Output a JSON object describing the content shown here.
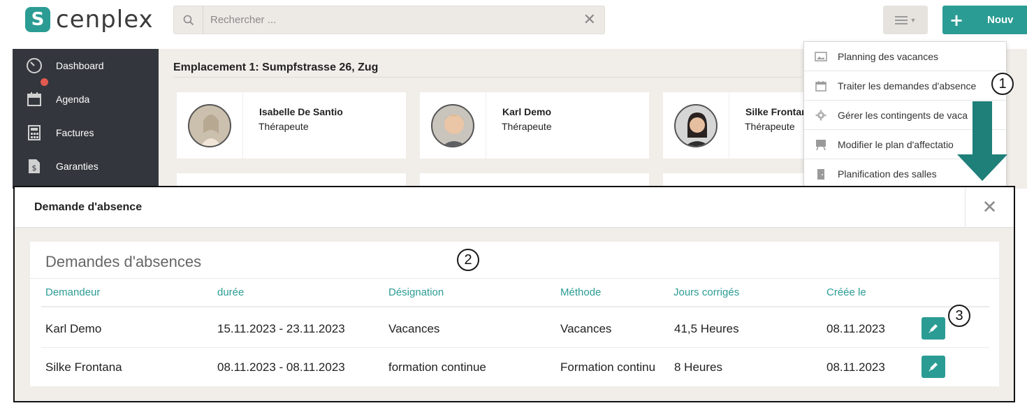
{
  "header": {
    "logo_mark": "S",
    "logo_text": "cenplex",
    "search_placeholder": "Rechercher ...",
    "menu_icon": "hamburger-icon",
    "new_button_label": "Nouv"
  },
  "sidebar": {
    "items": [
      {
        "label": "Dashboard",
        "icon": "dashboard-icon"
      },
      {
        "label": "Agenda",
        "icon": "calendar-icon"
      },
      {
        "label": "Factures",
        "icon": "calculator-icon"
      },
      {
        "label": "Garanties",
        "icon": "document-icon"
      }
    ]
  },
  "main": {
    "location_title": "Emplacement 1: Sumpfstrasse 26, Zug",
    "therapists": [
      {
        "name": "Isabelle De Santio",
        "role": "Thérapeute"
      },
      {
        "name": "Karl Demo",
        "role": "Thérapeute"
      },
      {
        "name": "Silke Frontar",
        "role": "Thérapeute"
      }
    ]
  },
  "dropdown": {
    "items": [
      {
        "label": "Planning des vacances",
        "icon": "image-icon"
      },
      {
        "label": "Traiter les demandes d'absence",
        "icon": "calendar-icon"
      },
      {
        "label": "Gérer les contingents de vaca",
        "icon": "gear-icon"
      },
      {
        "label": "Modifier le plan d'affectatio",
        "icon": "easel-icon"
      },
      {
        "label": "Planification des salles",
        "icon": "door-icon"
      }
    ]
  },
  "markers": [
    "1",
    "2",
    "3"
  ],
  "modal": {
    "title": "Demande d'absence",
    "close_symbol": "✕",
    "panel_title": "Demandes d'absences",
    "columns": [
      "Demandeur",
      "durée",
      "Désignation",
      "Méthode",
      "Jours corrigés",
      "Créée le"
    ],
    "rows": [
      {
        "demandeur": "Karl Demo",
        "duree": "15.11.2023 - 23.11.2023",
        "designation": "Vacances",
        "methode": "Vacances",
        "jours": "41,5 Heures",
        "creee": "08.11.2023"
      },
      {
        "demandeur": "Silke Frontana",
        "duree": "08.11.2023 - 08.11.2023",
        "designation": "formation continue",
        "methode": "Formation continu",
        "jours": "8 Heures",
        "creee": "08.11.2023"
      }
    ]
  },
  "colors": {
    "accent": "#2b9c94",
    "sidebar_bg": "#33373d",
    "page_bg": "#f1eeea",
    "arrow": "#1f7f79"
  }
}
